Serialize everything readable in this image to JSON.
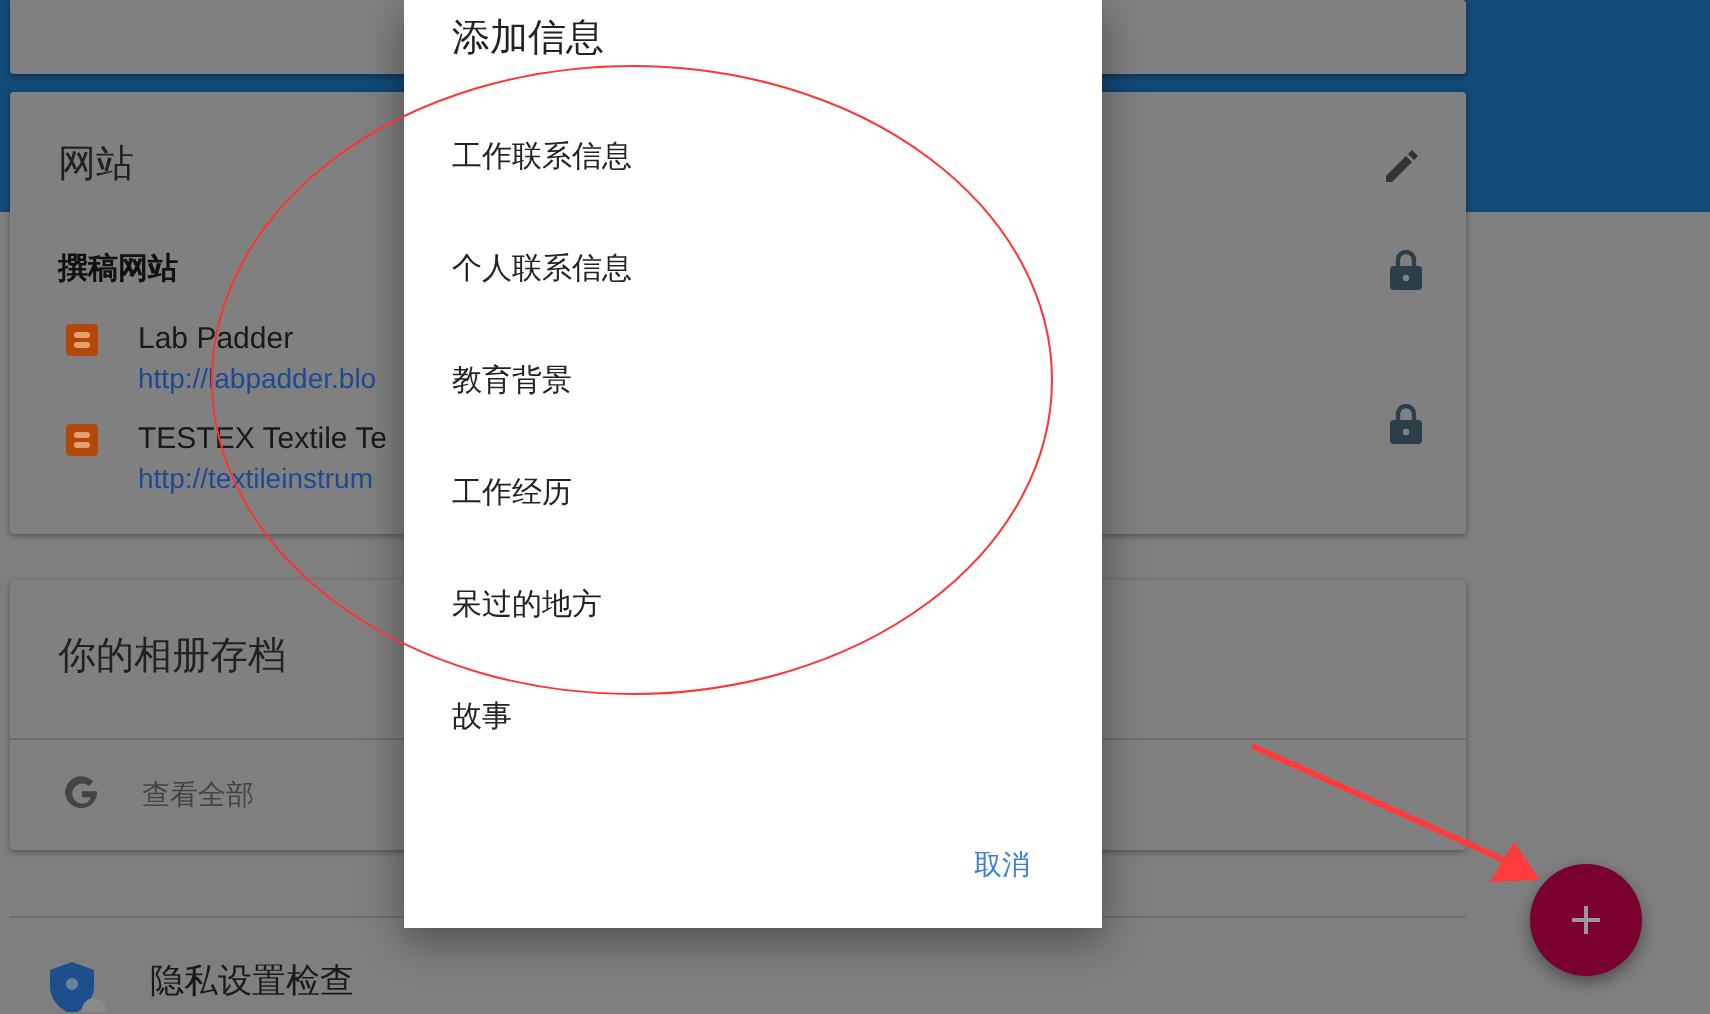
{
  "websites_card": {
    "title": "网站",
    "section": {
      "title": "撰稿网站",
      "locked": true
    },
    "sites": [
      {
        "name": "Lab Padder",
        "url": "http://labpadder.blo",
        "locked": false
      },
      {
        "name": "TESTEX Textile Te",
        "url": "http://textileinstrum",
        "locked": true
      }
    ]
  },
  "album_card": {
    "title": "你的相册存档",
    "link": "查看全部"
  },
  "privacy": {
    "label": "隐私设置检查"
  },
  "dialog": {
    "title": "添加信息",
    "options": [
      "工作联系信息",
      "个人联系信息",
      "教育背景",
      "工作经历",
      "呆过的地方",
      "故事"
    ],
    "cancel": "取消"
  }
}
